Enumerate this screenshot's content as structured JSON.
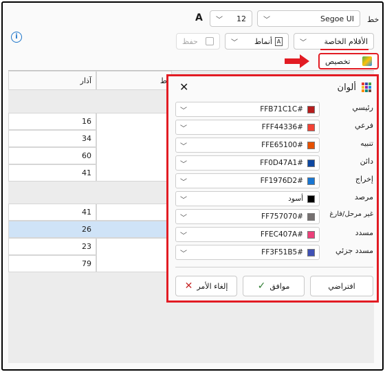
{
  "toolbar": {
    "font_label": "خط",
    "font_name": "Segoe UI",
    "font_size": "12",
    "font_size_icon": "A",
    "special_pens": "الأقلام الخاصة",
    "styles": "أنماط",
    "save": "حفظ",
    "customize": "تخصيص"
  },
  "grid": {
    "header": {
      "col_adar": "آذار",
      "col_partial": "ط"
    },
    "rows": [
      {
        "value": "",
        "type": "group"
      },
      {
        "value": "16"
      },
      {
        "value": "34"
      },
      {
        "value": "60"
      },
      {
        "value": "41"
      },
      {
        "value": "",
        "type": "group"
      },
      {
        "value": "41"
      },
      {
        "value": "26",
        "selected": true
      },
      {
        "value": "23"
      },
      {
        "value": "79"
      }
    ]
  },
  "popup": {
    "title": "ألوان",
    "colors": [
      {
        "label": "رئيسي",
        "value": "FFB71C1C#",
        "hex": "#B71C1C"
      },
      {
        "label": "فرعي",
        "value": "FFF44336#",
        "hex": "#F44336"
      },
      {
        "label": "تنبيه",
        "value": "FFE65100#",
        "hex": "#E65100"
      },
      {
        "label": "دائن",
        "value": "FF0D47A1#",
        "hex": "#0D47A1"
      },
      {
        "label": "إخراج",
        "value": "FF1976D2#",
        "hex": "#1976D2"
      },
      {
        "label": "مرصد",
        "value": "أسود",
        "hex": "#000000"
      },
      {
        "label": "غير مرحل/فارغ",
        "value": "FF757070#",
        "hex": "#757070"
      },
      {
        "label": "مسدد",
        "value": "FFEC407A#",
        "hex": "#EC407A"
      },
      {
        "label": "مسدد جزئي",
        "value": "FF3F51B5#",
        "hex": "#3F51B5"
      }
    ],
    "default_button": "افتراضي",
    "ok_button": "موافق",
    "cancel_button": "إلغاء الأمر"
  },
  "colors": {
    "highlight": "#e21b23",
    "arrow": "#e21b23",
    "selected_row": "#cfe3f7",
    "info": "#1a73c9"
  }
}
